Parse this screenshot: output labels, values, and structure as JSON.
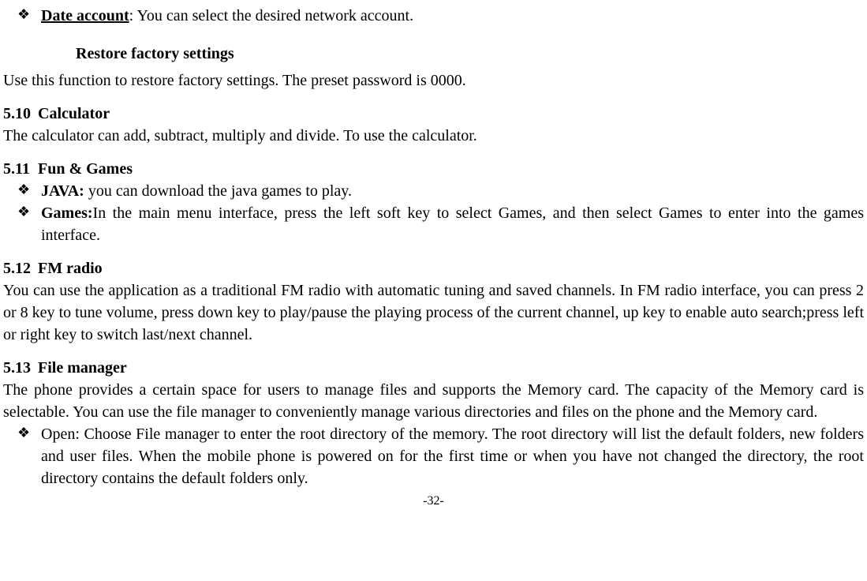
{
  "topBullet": {
    "label": "Date account",
    "text": ": You can select the desired network account."
  },
  "restoreHeading": "Restore factory settings",
  "restoreText": "Use this function to restore factory settings. The preset password is 0000.",
  "sec510": {
    "num": "5.10",
    "title": "Calculator",
    "text": "The calculator can add, subtract, multiply and divide. To use the calculator."
  },
  "sec511": {
    "num": "5.11",
    "title": "Fun & Games",
    "java": {
      "label": "JAVA:",
      "text": " you can download the java games to play."
    },
    "games": {
      "label": "Games:",
      "text": "In the main menu interface, press the left soft key to select Games, and then select Games to enter into the games interface."
    }
  },
  "sec512": {
    "num": "5.12",
    "title": "FM radio",
    "text": "You can use the application as a traditional FM radio with automatic tuning and saved channels. In FM radio interface, you can press 2 or 8 key to tune volume, press down key to play/pause the playing process of the current channel, up key to enable auto search;press left or right key to switch last/next channel."
  },
  "sec513": {
    "num": "5.13",
    "title": "File manager",
    "text": "The phone provides a certain space for users to manage files and supports the Memory card. The capacity of the Memory card is selectable. You can use the file manager to conveniently manage various directories and files on the phone and the Memory card.",
    "open": "Open: Choose File manager to enter the root directory of the memory. The root directory will list the default folders, new folders and user files. When the mobile phone is powered on for the first time or when you have not changed the directory, the root directory contains the default folders only."
  },
  "pageNumber": "-32-"
}
